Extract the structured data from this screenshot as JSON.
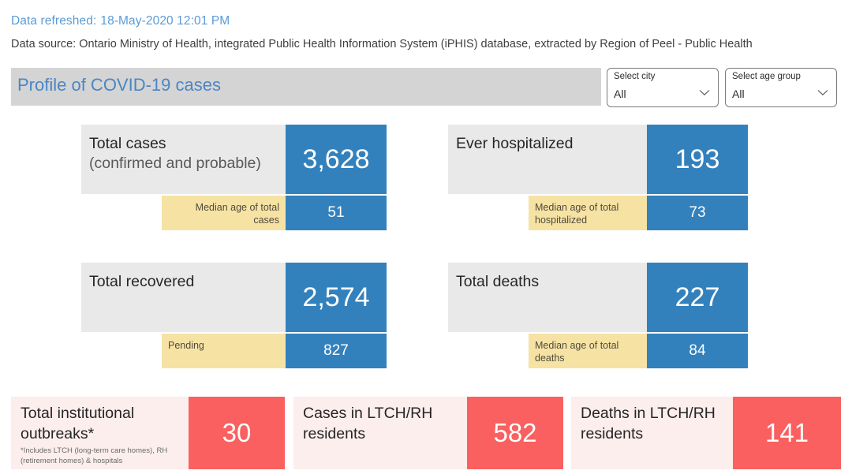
{
  "header": {
    "refreshed_label": "Data refreshed:",
    "refreshed_value": "18-May-2020 12:01 PM",
    "source_line": "Data source: Ontario Ministry of Health, integrated Public Health Information System (iPHIS) database, extracted by Region of Peel - Public Health",
    "title": "Profile of COVID-19 cases",
    "title_color": "#4a86c5",
    "refreshed_color": "#5B9BD5"
  },
  "filters": [
    {
      "id": "city",
      "label": "Select city",
      "value": "All",
      "chevron_icon": "chevron-down-icon"
    },
    {
      "id": "age_group",
      "label": "Select age group",
      "value": "All",
      "chevron_icon": "chevron-down-icon"
    }
  ],
  "kpi_cards": [
    {
      "id": "total-cases",
      "label_line1": "Total cases",
      "label_line2": "(confirmed and probable)",
      "value": "3,628",
      "sub_label": "Median age of total cases",
      "sub_value": "51"
    },
    {
      "id": "ever-hospitalized",
      "label_line1": "Ever hospitalized",
      "label_line2": "",
      "value": "193",
      "sub_label": "Median age of total hospitalized",
      "sub_value": "73"
    },
    {
      "id": "total-recovered",
      "label_line1": "Total recovered",
      "label_line2": "",
      "value": "2,574",
      "sub_label": "Pending",
      "sub_value": "827"
    },
    {
      "id": "total-deaths",
      "label_line1": "Total deaths",
      "label_line2": "",
      "value": "227",
      "sub_label": "Median age of total deaths",
      "sub_value": "84"
    }
  ],
  "outbreak_cards": [
    {
      "id": "total-institutional-outbreaks",
      "title": "Total institutional outbreaks*",
      "note": "*Includes LTCH (long-term care homes), RH (retirement homes) & hospitals",
      "value": "30"
    },
    {
      "id": "cases-in-ltch-rh-residents",
      "title": "Cases in LTCH/RH residents",
      "note": "",
      "value": "582"
    },
    {
      "id": "deaths-in-ltch-rh-residents",
      "title": "Deaths in LTCH/RH residents",
      "note": "",
      "value": "141"
    }
  ],
  "colors": {
    "blue_value": "#3281bd",
    "gray_label": "#e9e9e9",
    "yellow_sub_label": "#f6e3a4",
    "red_value": "#f9605f",
    "pink_label": "#fceeec",
    "title_bar": "#d4d4d4"
  }
}
